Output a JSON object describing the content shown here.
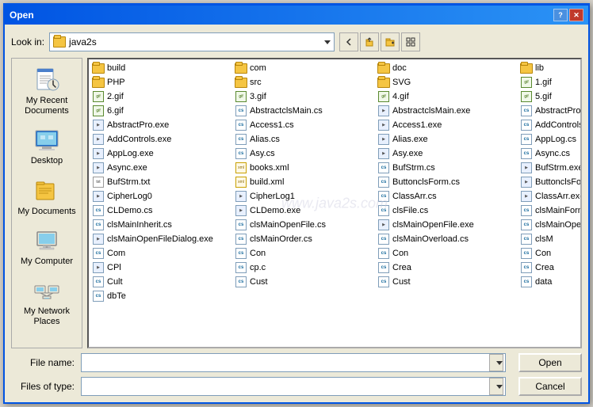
{
  "dialog": {
    "title": "Open",
    "help_btn": "?",
    "close_btn": "✕"
  },
  "toolbar": {
    "look_in_label": "Look in:",
    "current_folder": "java2s",
    "back_btn": "←",
    "up_btn": "↑",
    "new_folder_btn": "📁",
    "view_btn": "☰"
  },
  "left_panel": {
    "items": [
      {
        "id": "recent",
        "label": "My Recent\nDocuments"
      },
      {
        "id": "desktop",
        "label": "Desktop"
      },
      {
        "id": "mydocs",
        "label": "My Documents"
      },
      {
        "id": "mycomp",
        "label": "My Computer"
      },
      {
        "id": "network",
        "label": "My Network\nPlaces"
      }
    ]
  },
  "files": [
    {
      "name": "build",
      "type": "folder"
    },
    {
      "name": "com",
      "type": "folder"
    },
    {
      "name": "doc",
      "type": "folder"
    },
    {
      "name": "lib",
      "type": "folder"
    },
    {
      "name": "PHP",
      "type": "folder"
    },
    {
      "name": "src",
      "type": "folder"
    },
    {
      "name": "SVG",
      "type": "folder"
    },
    {
      "name": "1.gif",
      "type": "gif"
    },
    {
      "name": "2.gif",
      "type": "gif"
    },
    {
      "name": "3.gif",
      "type": "gif"
    },
    {
      "name": "4.gif",
      "type": "gif"
    },
    {
      "name": "5.gif",
      "type": "gif"
    },
    {
      "name": "6.gif",
      "type": "gif"
    },
    {
      "name": "AbstractclsMain.cs",
      "type": "cs"
    },
    {
      "name": "AbstractclsMain.exe",
      "type": "exe"
    },
    {
      "name": "AbstractPro.cs",
      "type": "cs"
    },
    {
      "name": "AbstractPro.exe",
      "type": "exe"
    },
    {
      "name": "Access1.cs",
      "type": "cs"
    },
    {
      "name": "Access1.exe",
      "type": "exe"
    },
    {
      "name": "AddControls.cs",
      "type": "cs"
    },
    {
      "name": "AddControls.exe",
      "type": "exe"
    },
    {
      "name": "Alias.cs",
      "type": "cs"
    },
    {
      "name": "Alias.exe",
      "type": "exe"
    },
    {
      "name": "AppLog.cs",
      "type": "cs"
    },
    {
      "name": "AppLog.exe",
      "type": "exe"
    },
    {
      "name": "Asy.cs",
      "type": "cs"
    },
    {
      "name": "Asy.exe",
      "type": "exe"
    },
    {
      "name": "Async.cs",
      "type": "cs"
    },
    {
      "name": "Async.exe",
      "type": "exe"
    },
    {
      "name": "books.xml",
      "type": "xml"
    },
    {
      "name": "BufStrm.cs",
      "type": "cs"
    },
    {
      "name": "BufStrm.exe",
      "type": "exe"
    },
    {
      "name": "BufStrm.txt",
      "type": "txt"
    },
    {
      "name": "build.xml",
      "type": "xml"
    },
    {
      "name": "ButtonclsForm.cs",
      "type": "cs"
    },
    {
      "name": "ButtonclsForm.exe",
      "type": "exe"
    },
    {
      "name": "CipherLog0",
      "type": "exe"
    },
    {
      "name": "CipherLog1",
      "type": "exe"
    },
    {
      "name": "ClassArr.cs",
      "type": "cs"
    },
    {
      "name": "ClassArr.exe",
      "type": "exe"
    },
    {
      "name": "CLDemo.cs",
      "type": "cs"
    },
    {
      "name": "CLDemo.exe",
      "type": "exe"
    },
    {
      "name": "clsFile.cs",
      "type": "cs"
    },
    {
      "name": "clsMainForm.cs",
      "type": "cs"
    },
    {
      "name": "clsMainInherit.cs",
      "type": "cs"
    },
    {
      "name": "clsMainOpenFile.cs",
      "type": "cs"
    },
    {
      "name": "clsMainOpenFile.exe",
      "type": "exe"
    },
    {
      "name": "clsMainOpenFileDialog.cs",
      "type": "cs"
    },
    {
      "name": "clsMainOpenFileDialog.exe",
      "type": "exe"
    },
    {
      "name": "clsMainOrder.cs",
      "type": "cs"
    },
    {
      "name": "clsMainOverload.cs",
      "type": "cs"
    },
    {
      "name": "clsM",
      "type": "cs"
    },
    {
      "name": "Com",
      "type": "cs"
    },
    {
      "name": "Con",
      "type": "cs"
    },
    {
      "name": "Con",
      "type": "cs"
    },
    {
      "name": "Con",
      "type": "cs"
    },
    {
      "name": "CPl",
      "type": "exe"
    },
    {
      "name": "cp.c",
      "type": "cs"
    },
    {
      "name": "Crea",
      "type": "cs"
    },
    {
      "name": "Crea",
      "type": "cs"
    },
    {
      "name": "Cult",
      "type": "cs"
    },
    {
      "name": "Cust",
      "type": "cs"
    },
    {
      "name": "Cust",
      "type": "cs"
    },
    {
      "name": "data",
      "type": "cs"
    },
    {
      "name": "dbTe",
      "type": "cs"
    }
  ],
  "bottom": {
    "file_name_label": "File name:",
    "file_name_value": "",
    "file_type_label": "Files of type:",
    "file_type_value": "",
    "open_btn": "Open",
    "cancel_btn": "Cancel"
  },
  "watermark": "www.java2s.com"
}
